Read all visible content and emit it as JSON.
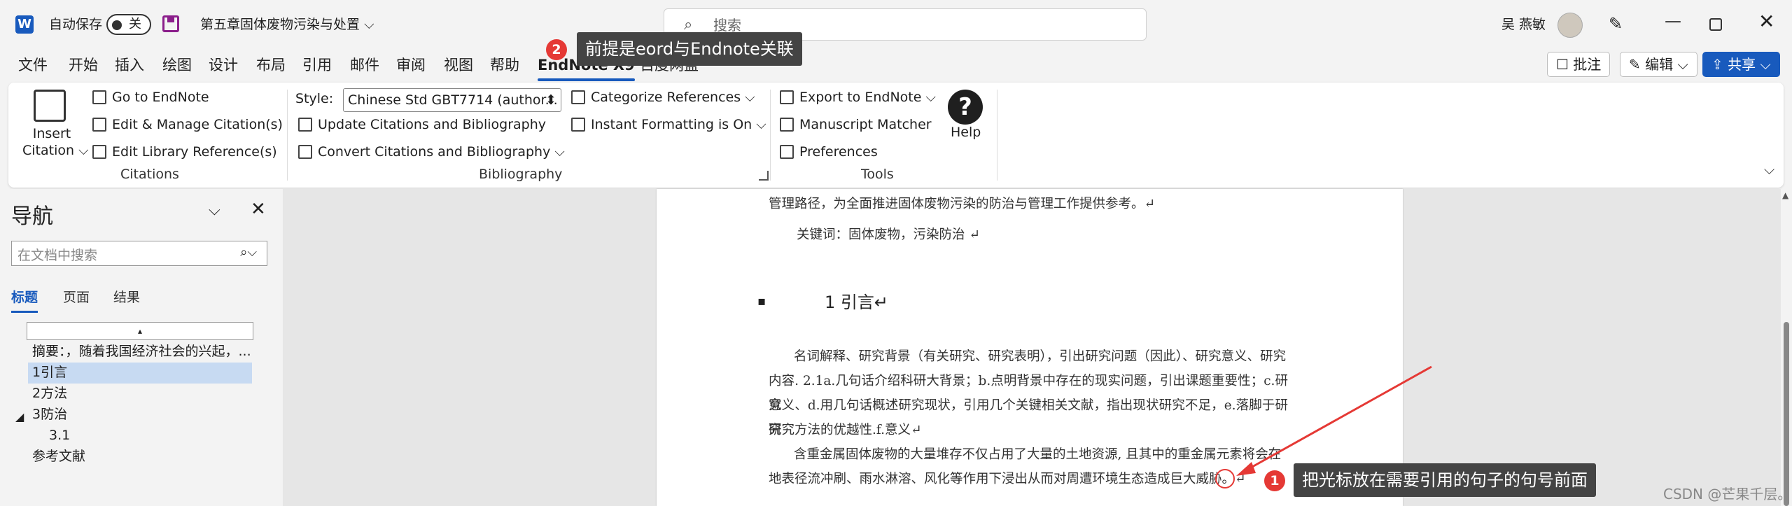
{
  "titlebar": {
    "app_logo": "W",
    "autosave_label": "自动保存",
    "autosave_state": "关",
    "doc_title": "第五章固体废物污染与处置",
    "search_placeholder": "搜索",
    "user_name": "吴 燕敏",
    "icons": [
      "word-logo",
      "save-icon",
      "search-icon",
      "avatar",
      "pen-icon",
      "minimize-icon",
      "maximize-icon",
      "close-icon"
    ]
  },
  "menu": {
    "tabs": [
      "文件",
      "开始",
      "插入",
      "绘图",
      "设计",
      "布局",
      "引用",
      "邮件",
      "审阅",
      "视图",
      "帮助",
      "EndNote X9",
      "百度网盘"
    ],
    "active_tab": "EndNote X9",
    "comment_btn": "批注",
    "edit_btn": "编辑",
    "share_btn": "共享"
  },
  "ribbon": {
    "citations": {
      "insert_citation_line1": "Insert",
      "insert_citation_line2": "Citation",
      "go_to_endnote": "Go to EndNote",
      "edit_manage": "Edit & Manage Citation(s)",
      "edit_library": "Edit Library Reference(s)",
      "group_label": "Citations"
    },
    "bibliography": {
      "style_label": "Style:",
      "style_value": "Chinese Std GBT7714 (author...",
      "update": "Update Citations and Bibliography",
      "convert": "Convert Citations and Bibliography",
      "categorize": "Categorize References",
      "instant_formatting": "Instant Formatting is On",
      "group_label": "Bibliography"
    },
    "tools": {
      "export": "Export to EndNote",
      "manuscript_matcher": "Manuscript Matcher",
      "preferences": "Preferences",
      "group_label": "Tools"
    },
    "help_label": "Help"
  },
  "nav": {
    "title": "导航",
    "search_placeholder": "在文档中搜索",
    "tabs": [
      "标题",
      "页面",
      "结果"
    ],
    "active_tab": "标题",
    "headings": [
      {
        "label": "摘要：，随着我国经济社会的兴起，...",
        "level": 1,
        "selected": false
      },
      {
        "label": "1引言",
        "level": 1,
        "selected": true
      },
      {
        "label": "2方法",
        "level": 1,
        "selected": false
      },
      {
        "label": "3防治",
        "level": 1,
        "selected": false
      },
      {
        "label": "3.1",
        "level": 2,
        "selected": false
      },
      {
        "label": "参考文献",
        "level": 1,
        "selected": false
      }
    ]
  },
  "document": {
    "line1": "管理路径，为全面推进固体废物污染的防治与管理工作提供参考。↵",
    "keywords": "关键词：固体废物，污染防治 ↵",
    "heading": "1 引言↵",
    "para1_l1": "名词解释、研究背景（有关研究、研究表明），引出研究问题（因此）、研究意义、研究",
    "para1_l2": "内容. 2.1a.几句话介绍科研大背景；b.点明背景中存在的现实问题，引出课题重要性；c.研究",
    "para1_l3": "意义、d.用几句话概述研究现状，引用几个关键相关文献，指出现状研究不足，e.落脚于研究",
    "para1_l4": "研究方法的优越性.f.意义↵",
    "para2_l1": "含重金属固体废物的大量堆存不仅占用了大量的土地资源, 且其中的重金属元素将会在",
    "para2_l2": "地表径流冲刷、雨水淋溶、风化等作用下浸出从而对周遭环境生态造成巨大威胁。↵"
  },
  "annotations": {
    "badge1": "1",
    "badge2": "2",
    "callout1": "把光标放在需要引用的句子的句号前面",
    "callout2": "前提是eord与Endnote关联",
    "accent": "#e53935"
  },
  "watermark": "CSDN @芒果千层。"
}
